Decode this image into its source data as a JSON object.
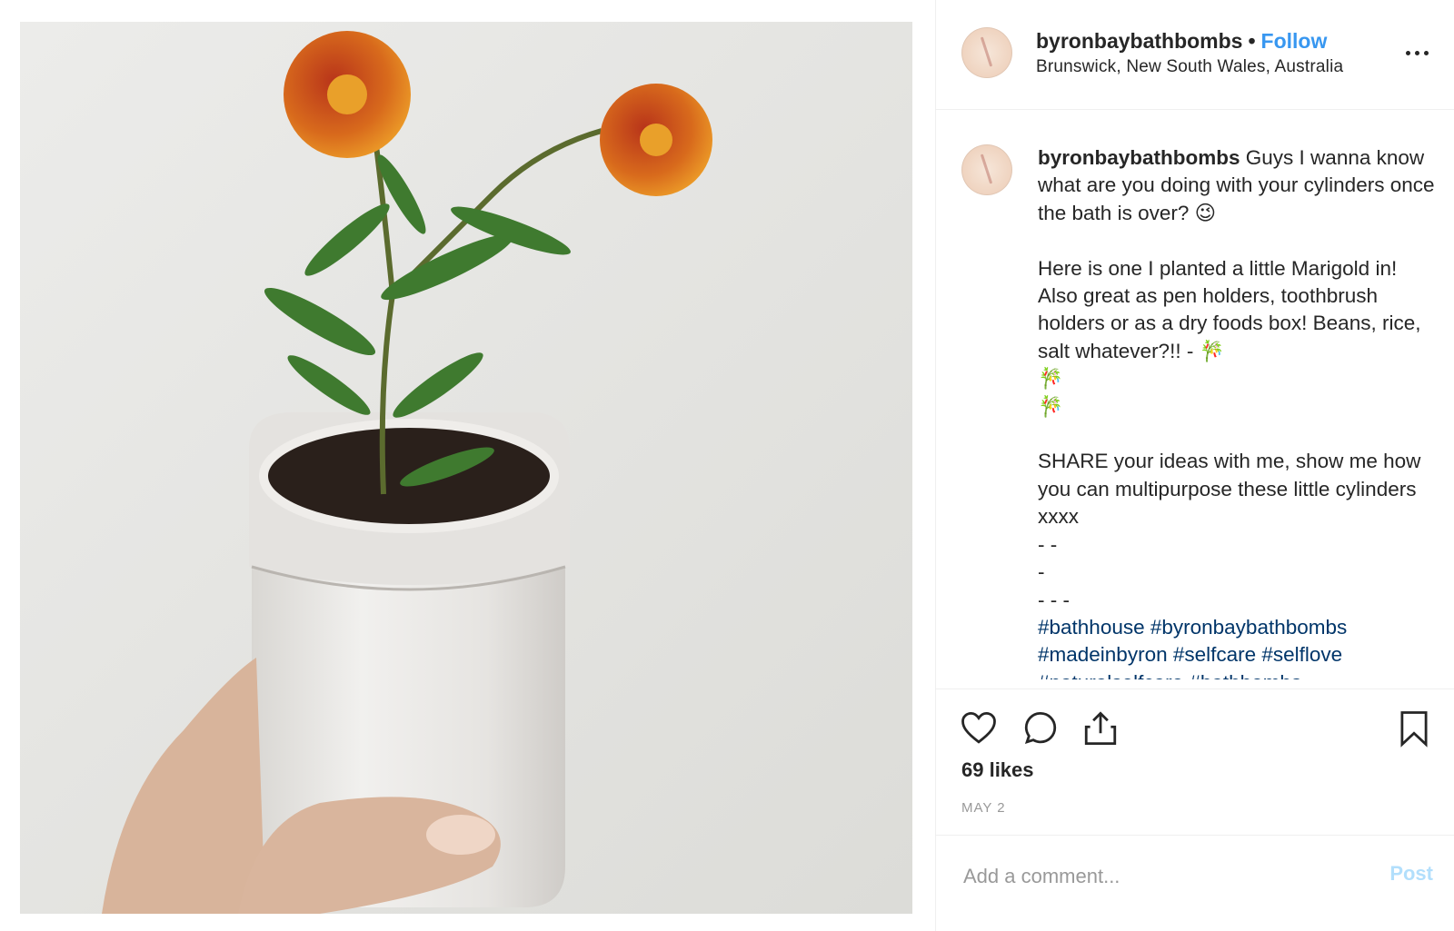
{
  "post": {
    "username": "byronbaybathbombs",
    "separator": "•",
    "follow_label": "Follow",
    "location": "Brunswick, New South Wales, Australia"
  },
  "caption": {
    "username": "byronbaybathbombs",
    "text": " Guys I wanna know what are you doing with your cylinders once the bath is over? 😉\n\nHere is one I planted a little Marigold in! Also great as pen holders, toothbrush holders or as a dry foods box! Beans, rice, salt whatever?!! - 🎋\n🎋\n🎋\n\nSHARE your ideas with me, show me how you can multipurpose these little cylinders xxxx\n- -\n-\n- - -",
    "hashtags": "#bathhouse #byronbaybathbombs #madeinbyron #selfcare #selflove #naturalselfcare #bathbombs"
  },
  "engagement": {
    "likes": "69 likes",
    "date": "MAY 2"
  },
  "comment": {
    "placeholder": "Add a comment...",
    "post_label": "Post"
  },
  "icons": {
    "like": "heart-icon",
    "comment": "comment-bubble-icon",
    "share": "share-icon",
    "save": "bookmark-icon",
    "more": "more-options-icon"
  },
  "colors": {
    "follow": "#3897f0",
    "hashtag": "#003569",
    "post_disabled": "#b2dffc",
    "muted": "#999999"
  }
}
